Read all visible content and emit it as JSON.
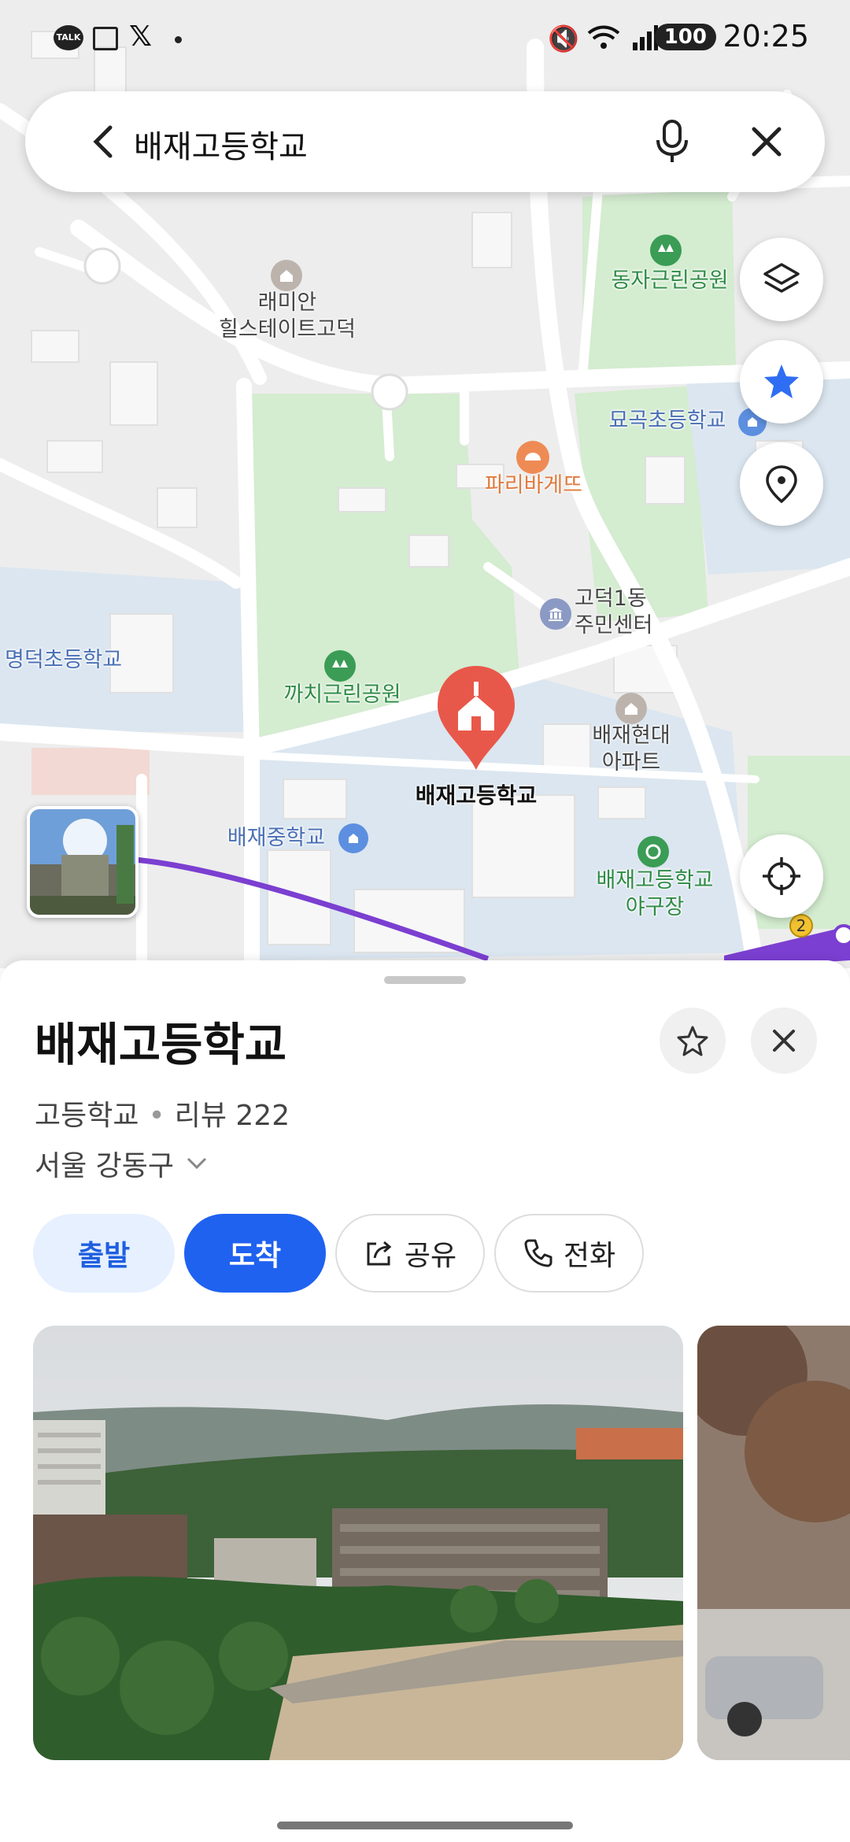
{
  "status_bar": {
    "time": "20:25",
    "battery": "100",
    "notification_icons": [
      "kakaotalk-icon",
      "news-icon",
      "x-icon"
    ]
  },
  "search": {
    "query": "배재고등학교"
  },
  "map": {
    "labels": {
      "remian": "래미안\n힐스테이트고덕",
      "dongja_park": "동자근린공원",
      "myogok_school": "묘곡초등학교",
      "paris": "파리바게뜨",
      "center": "고덕1동\n주민센터",
      "myeongdeok": "명덕초등학교",
      "kkachi_park": "까치근린공원",
      "baejae_apt": "배재현대\n아파트",
      "selected": "배재고등학교",
      "baejae_middle": "배재중학교",
      "baseball": "배재고등학교\n야구장",
      "route_badge": "2"
    }
  },
  "place": {
    "title": "배재고등학교",
    "category": "고등학교",
    "reviews": "리뷰 222",
    "location": "서울 강동구"
  },
  "actions": {
    "start": "출발",
    "arrive": "도착",
    "share": "공유",
    "call": "전화"
  },
  "colors": {
    "accent": "#1f62f0",
    "pin": "#e8584a",
    "route": "#7b3fd1"
  }
}
